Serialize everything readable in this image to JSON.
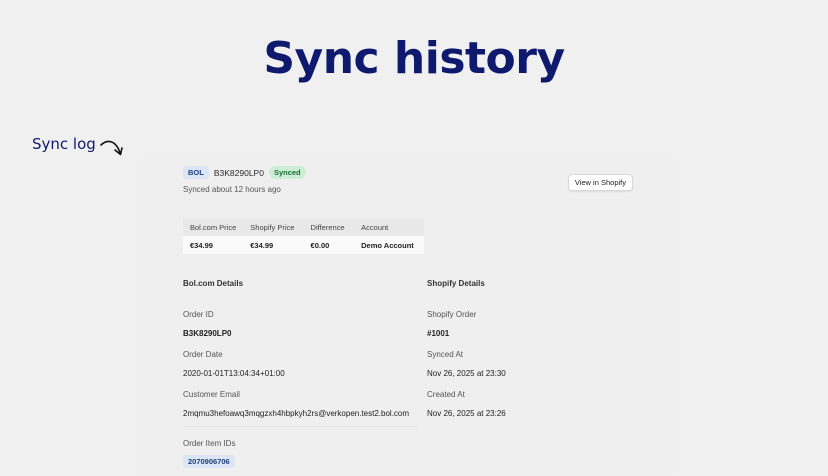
{
  "hero": {
    "title": "Sync history"
  },
  "annotation": {
    "label": "Sync log"
  },
  "record": {
    "source_badge": "BOL",
    "order_code": "B3K8290LP0",
    "status": "Synced",
    "synced_ago": "Synced about 12 hours ago",
    "view_button": "View in Shopify"
  },
  "price_table": {
    "headers": [
      "Bol.com Price",
      "Shopify Price",
      "Difference",
      "Account"
    ],
    "values": [
      "€34.99",
      "€34.99",
      "€0.00",
      "Demo Account"
    ]
  },
  "bol_details": {
    "title": "Bol.com Details",
    "order_id_label": "Order ID",
    "order_id": "B3K8290LP0",
    "order_date_label": "Order Date",
    "order_date": "2020-01-01T13:04:34+01:00",
    "email_label": "Customer Email",
    "email": "2mqmu3hefoawq3mqgzxh4hbpkyh2rs@verkopen.test2.bol.com",
    "item_ids_label": "Order Item IDs",
    "item_ids": [
      "2070906706"
    ]
  },
  "shopify_details": {
    "title": "Shopify Details",
    "order_label": "Shopify Order",
    "order": "#1001",
    "synced_at_label": "Synced At",
    "synced_at": "Nov 26, 2025 at 23:30",
    "created_at_label": "Created At",
    "created_at": "Nov 26, 2025 at 23:26"
  },
  "colors": {
    "background": "#f0f0f0",
    "hero": "#0f1a6e",
    "badge_blue": "#dbe5f6",
    "badge_green": "#cdeed5"
  }
}
